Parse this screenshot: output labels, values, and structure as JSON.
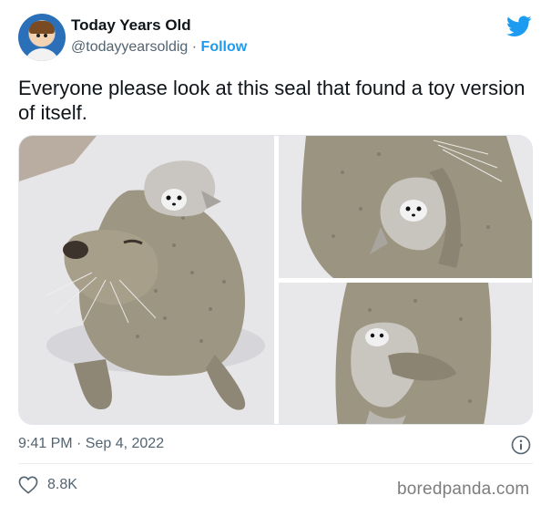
{
  "author": {
    "name": "Today Years Old",
    "handle": "@todayyearsoldig",
    "separator": "·",
    "follow_label": "Follow",
    "avatar_icon": "profile-photo",
    "platform_icon": "twitter-bird-icon",
    "brand_color": "#1d9bf0"
  },
  "tweet": {
    "text": "Everyone please look at this seal that found a toy version of itself.",
    "timestamp": "9:41 PM · Sep 4, 2022",
    "likes": "8.8K"
  },
  "media": {
    "photo_count": 3
  },
  "watermark": "boredpanda.com"
}
